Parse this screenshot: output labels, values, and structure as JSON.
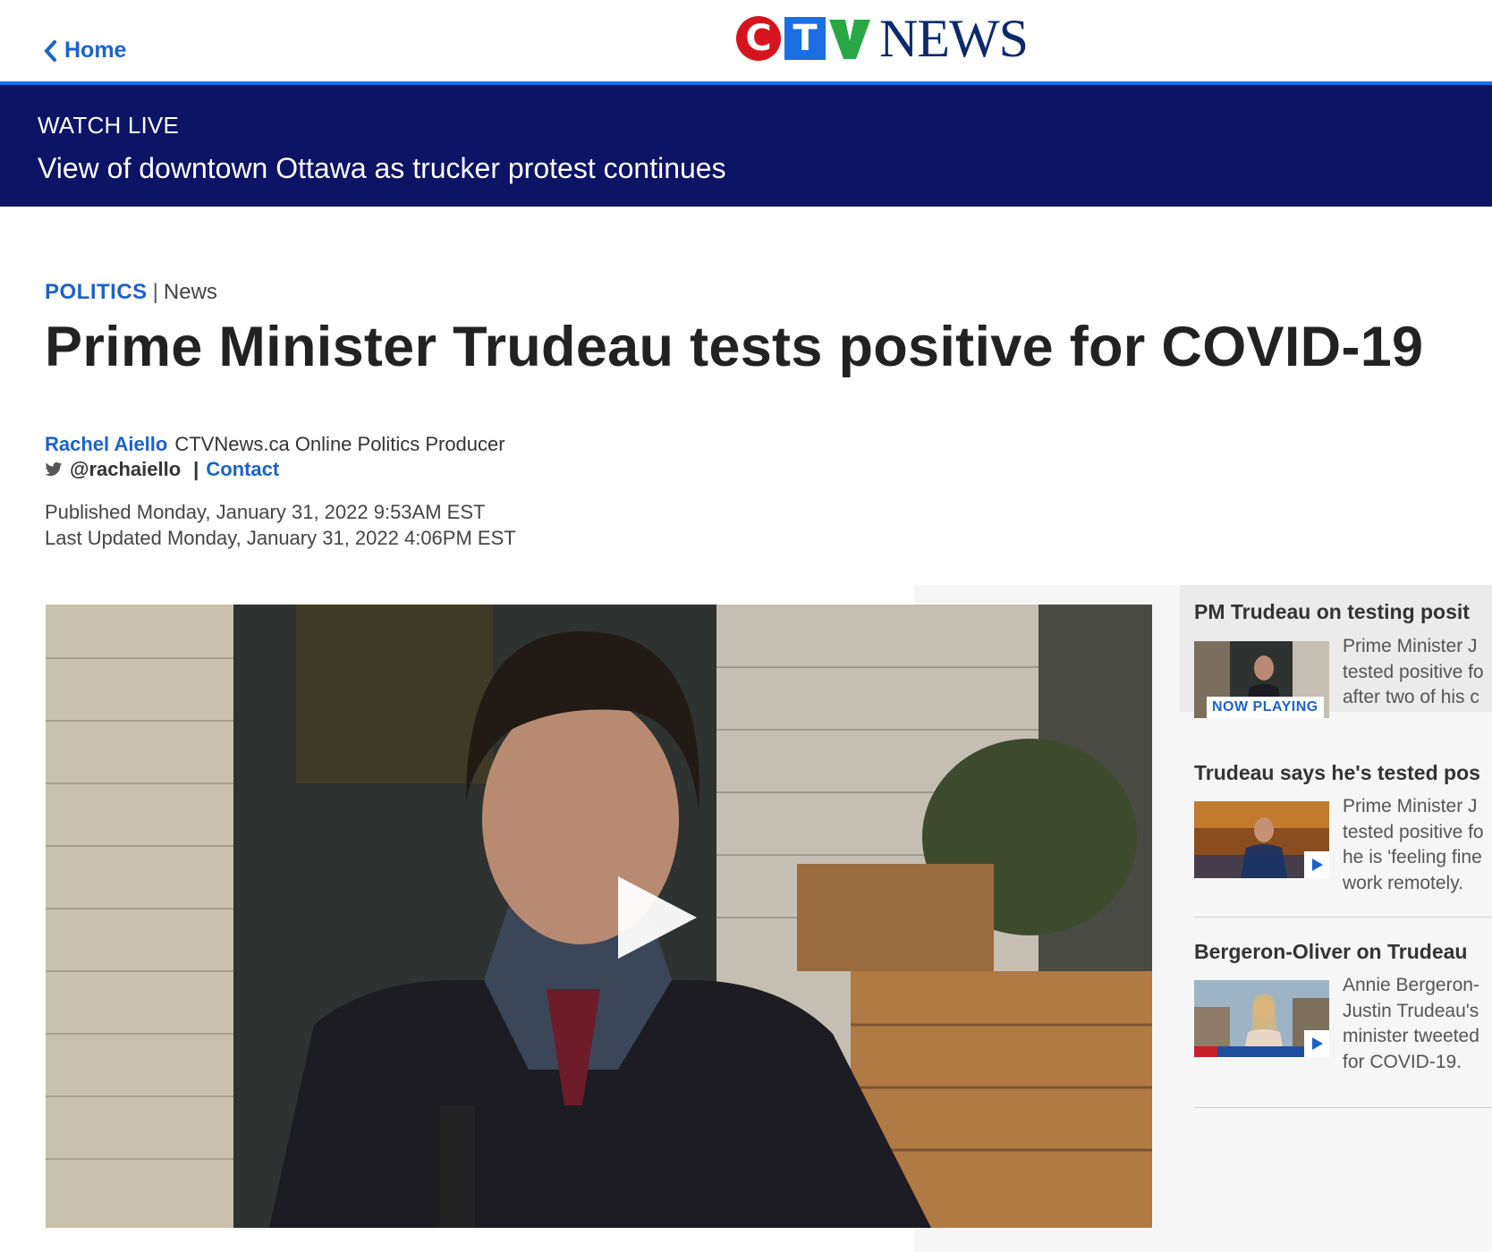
{
  "nav": {
    "home_label": "Home"
  },
  "logo": {
    "letters": [
      "C",
      "T",
      "V"
    ],
    "wordmark": "NEWS"
  },
  "watch_live": {
    "label": "WATCH LIVE",
    "title": "View of downtown Ottawa as trucker protest continues"
  },
  "article": {
    "category": "POLITICS",
    "separator": "|",
    "section": "News",
    "headline": "Prime Minister Trudeau tests positive for COVID-19",
    "author": "Rachel Aiello",
    "author_role": "CTVNews.ca Online Politics Producer",
    "twitter_handle": "@rachaiello",
    "contact_label": "Contact",
    "published": "Published Monday, January 31, 2022 9:53AM EST",
    "updated": "Last Updated Monday, January 31, 2022 4:06PM EST"
  },
  "related_videos": [
    {
      "title": "PM Trudeau on testing posit",
      "desc_lines": [
        "Prime Minister J",
        "tested positive fo",
        "after two of his c"
      ],
      "badge": "NOW PLAYING"
    },
    {
      "title": "Trudeau says he's tested pos",
      "desc_lines": [
        "Prime Minister J",
        "tested positive fo",
        "he is 'feeling fine",
        "work remotely."
      ]
    },
    {
      "title": "Bergeron-Oliver on Trudeau",
      "desc_lines": [
        "Annie Bergeron-",
        "Justin Trudeau's",
        "minister tweeted",
        "for COVID-19."
      ]
    }
  ],
  "colors": {
    "accent_blue": "#1c63c9",
    "live_banner": "#0b1465",
    "logo_red": "#d7141d",
    "logo_blue": "#1a6ee0",
    "logo_green": "#2aa745"
  }
}
